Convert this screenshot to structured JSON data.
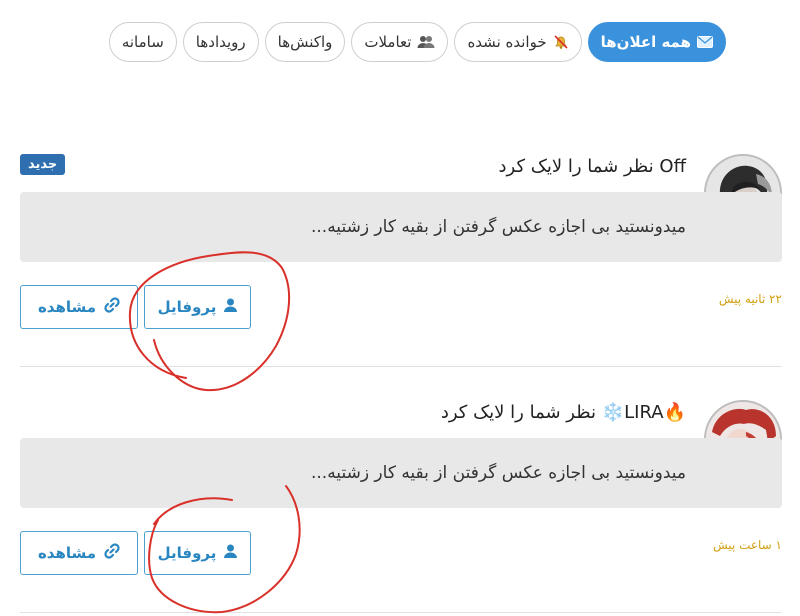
{
  "tabs": [
    {
      "label": "همه اعلان‌ها",
      "icon": "envelope-icon",
      "active": true
    },
    {
      "label": "خوانده نشده",
      "icon": "bell-off-icon",
      "active": false
    },
    {
      "label": "تعاملات",
      "icon": "users-icon",
      "active": false
    },
    {
      "label": "واکنش‌ها",
      "icon": "",
      "active": false
    },
    {
      "label": "رویدادها",
      "icon": "",
      "active": false
    },
    {
      "label": "سامانه",
      "icon": "",
      "active": false
    }
  ],
  "notifications": [
    {
      "user": "Off",
      "action": " نظر شما را لایک کرد",
      "badge": "جدید",
      "quote": "میدونستید بی اجازه عکس گرفتن از بقیه کار زشتیه...",
      "profile_label": "پروفایل",
      "view_label": "مشاهده",
      "time": "۲۲ ثانیه پیش"
    },
    {
      "user": "🔥LIRA❄️",
      "action": " نظر شما را لایک کرد",
      "badge": "",
      "quote": "میدونستید بی اجازه عکس گرفتن از بقیه کار زشتیه...",
      "profile_label": "پروفایل",
      "view_label": "مشاهده",
      "time": "۱ ساعت پیش"
    }
  ],
  "colors": {
    "accent": "#3a92dd",
    "badge": "#2f6fb0",
    "button_text": "#2a86c0",
    "time": "#d2a013",
    "annotation": "#d9302a"
  }
}
